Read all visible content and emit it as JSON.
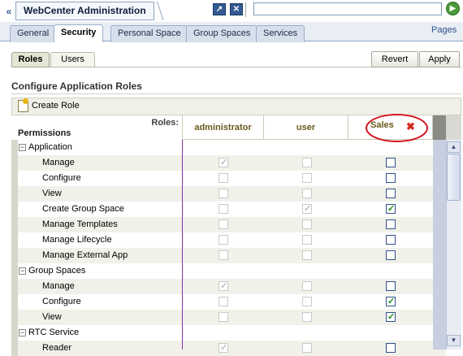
{
  "header": {
    "title": "WebCenter Administration",
    "collapse_glyph": "«",
    "icons": [
      "share-icon",
      "close-icon",
      "go-icon"
    ],
    "search_value": ""
  },
  "tabs": [
    {
      "label": "General",
      "active": false
    },
    {
      "label": "Security",
      "active": true
    },
    {
      "label": "Personal Space",
      "active": false
    },
    {
      "label": "Group Spaces",
      "active": false
    },
    {
      "label": "Services",
      "active": false
    }
  ],
  "pages_link": "Pages",
  "subtabs": {
    "roles": "Roles",
    "users": "Users"
  },
  "actions": {
    "revert": "Revert",
    "apply": "Apply"
  },
  "section_title": "Configure Application Roles",
  "toolbar": {
    "create_role": "Create Role"
  },
  "table": {
    "roles_label": "Roles:",
    "permissions_label": "Permissions",
    "columns": [
      "administrator",
      "user",
      "Sales"
    ],
    "rows": [
      {
        "label": "Application",
        "type": "group",
        "expander": "−"
      },
      {
        "label": "Manage",
        "type": "child",
        "admin": true,
        "user": false,
        "sales": false
      },
      {
        "label": "Configure",
        "type": "child",
        "admin": false,
        "user": false,
        "sales": false
      },
      {
        "label": "View",
        "type": "child",
        "admin": false,
        "user": false,
        "sales": false
      },
      {
        "label": "Create Group Space",
        "type": "child",
        "admin": false,
        "user": true,
        "sales": true
      },
      {
        "label": "Manage Templates",
        "type": "child",
        "admin": false,
        "user": false,
        "sales": false
      },
      {
        "label": "Manage Lifecycle",
        "type": "child",
        "admin": false,
        "user": false,
        "sales": false
      },
      {
        "label": "Manage External App",
        "type": "child",
        "admin": false,
        "user": false,
        "sales": false
      },
      {
        "label": "Group Spaces",
        "type": "group",
        "expander": "−"
      },
      {
        "label": "Manage",
        "type": "child",
        "admin": true,
        "user": false,
        "sales": false
      },
      {
        "label": "Configure",
        "type": "child",
        "admin": false,
        "user": false,
        "sales": true
      },
      {
        "label": "View",
        "type": "child",
        "admin": false,
        "user": false,
        "sales": true
      },
      {
        "label": "RTC Service",
        "type": "group",
        "expander": "−"
      },
      {
        "label": "Reader",
        "type": "child",
        "admin": true,
        "user": false,
        "sales": false
      }
    ]
  },
  "colors": {
    "accent": "#2c4f8c",
    "highlight_oval": "#d4101a",
    "checked": "#1f8a1f"
  }
}
